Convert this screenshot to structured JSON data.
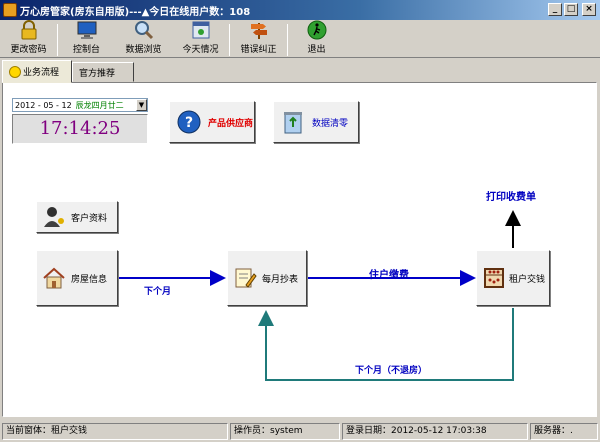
{
  "window": {
    "title": "万心房管家(房东自用版)---▲今日在线用户数：108"
  },
  "toolbar": {
    "items": [
      {
        "label": "更改密码",
        "icon": "lock-icon"
      },
      {
        "label": "控制台",
        "icon": "monitor-icon"
      },
      {
        "label": "数据浏览",
        "icon": "magnifier-icon"
      },
      {
        "label": "今天情况",
        "icon": "calendar-icon"
      },
      {
        "label": "错误纠正",
        "icon": "signpost-icon"
      },
      {
        "label": "退出",
        "icon": "exit-icon"
      }
    ]
  },
  "tabs": [
    {
      "label": "业务流程",
      "active": true
    },
    {
      "label": "官方推荐",
      "active": false
    }
  ],
  "date": {
    "value": "2012 - 05 - 12",
    "lunar": "辰龙四月廿二",
    "clock": "17:14:25"
  },
  "buttons": {
    "supplier": "产品供应商",
    "clear_data": "数据清零",
    "customer": "客户资料",
    "house": "房屋信息",
    "meter": "每月抄表",
    "tenant_pay": "租户交钱"
  },
  "flow": {
    "next_month": "下个月",
    "resident_pay": "住户缴费",
    "print_receipt": "打印收费单",
    "next_month_no_leave": "下个月（不退房）"
  },
  "status": {
    "current_form": "当前窗体：租户交钱",
    "operator": "操作员：system",
    "login_date": "登录日期：2012-05-12 17:03:38",
    "server": "服务器：."
  },
  "colors": {
    "flow_blue": "#0000c8",
    "flow_teal": "#1f7a7a",
    "clock_text": "#800080",
    "title_bar": "#0a246a"
  }
}
